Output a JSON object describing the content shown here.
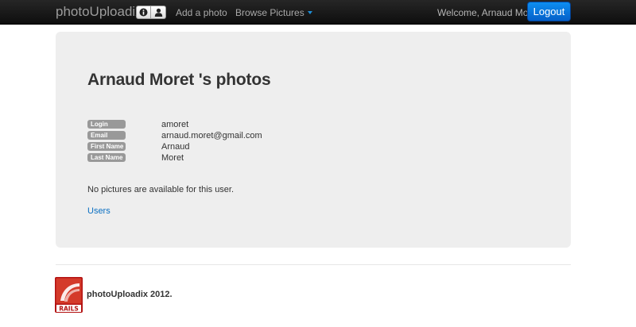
{
  "navbar": {
    "brand": "photoUploadix",
    "add_photo": "Add a photo",
    "browse_pictures": "Browse Pictures",
    "welcome": "Welcome, Arnaud Moret",
    "logout": "Logout",
    "icons": [
      "info-icon",
      "user-icon"
    ]
  },
  "profile": {
    "title": "Arnaud Moret 's photos",
    "fields": [
      {
        "label": "Login",
        "value": "amoret"
      },
      {
        "label": "Email",
        "value": "arnaud.moret@gmail.com"
      },
      {
        "label": "First Name",
        "value": "Arnaud"
      },
      {
        "label": "Last Name",
        "value": "Moret"
      }
    ],
    "empty_message": "No pictures are available for this user.",
    "users_link": "Users"
  },
  "footer": {
    "logo_text": "RAILS",
    "copyright": "photoUploadix 2012."
  },
  "colors": {
    "navbar_bg": "#1b1b1b",
    "logout_button": "#0a74da",
    "hero_bg": "#eeeeee",
    "label_bg": "#999999",
    "link": "#0a6fc2",
    "caret": "#1e8fd8"
  }
}
